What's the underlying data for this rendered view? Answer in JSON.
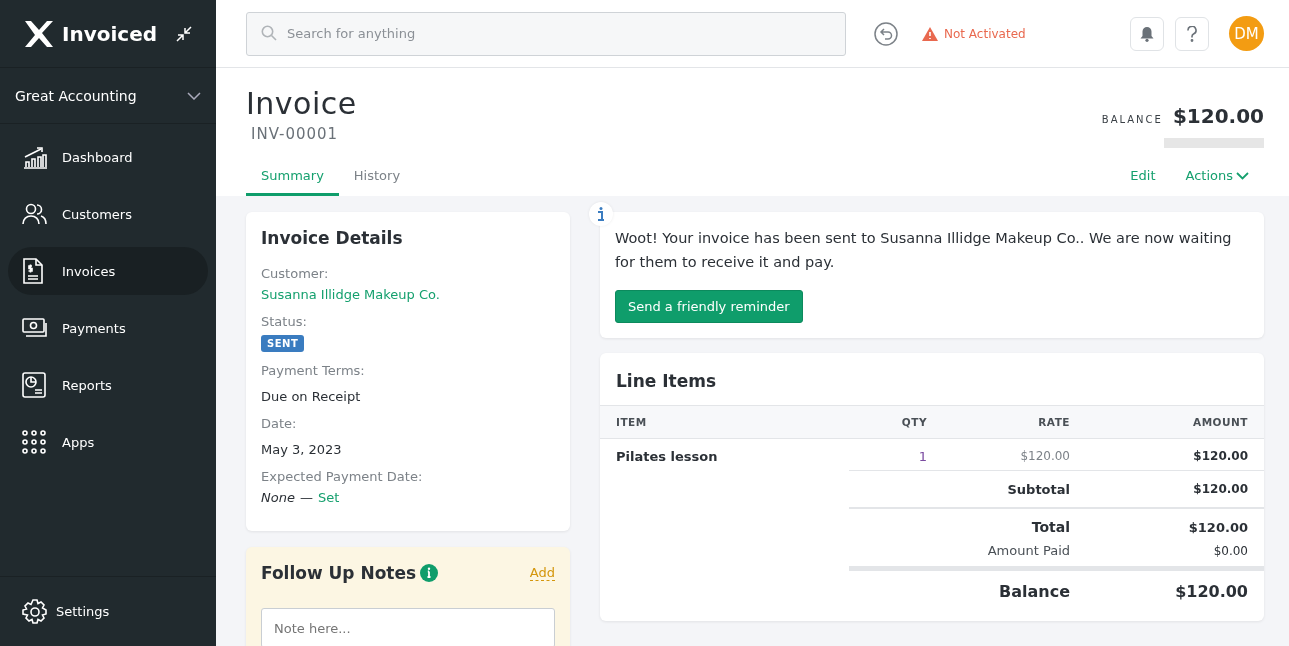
{
  "brand": {
    "name": "Invoiced"
  },
  "company": {
    "name": "Great Accounting"
  },
  "nav": [
    {
      "label": "Dashboard",
      "kind": "chart",
      "selected": false
    },
    {
      "label": "Customers",
      "kind": "people",
      "selected": false
    },
    {
      "label": "Invoices",
      "kind": "invoice",
      "selected": true
    },
    {
      "label": "Payments",
      "kind": "cash",
      "selected": false
    },
    {
      "label": "Reports",
      "kind": "report",
      "selected": false
    },
    {
      "label": "Apps",
      "kind": "grid",
      "selected": false
    }
  ],
  "settings": {
    "label": "Settings"
  },
  "search": {
    "placeholder": "Search for anything"
  },
  "activation": {
    "text": "Not Activated"
  },
  "avatar": {
    "initials": "DM"
  },
  "page": {
    "title": "Invoice",
    "number": "INV-00001",
    "balance_label": "BALANCE",
    "balance": "$120.00"
  },
  "tabs": [
    {
      "label": "Summary",
      "selected": true
    },
    {
      "label": "History",
      "selected": false
    }
  ],
  "actions": [
    {
      "label": "Edit",
      "kind": "link"
    },
    {
      "label": "Actions",
      "kind": "menu"
    }
  ],
  "details": {
    "title": "Invoice Details",
    "fields": [
      {
        "label": "Customer:",
        "value": "Susanna Illidge Makeup Co.",
        "kind": "link"
      },
      {
        "label": "Status:",
        "value": "SENT",
        "kind": "badge"
      },
      {
        "label": "Payment Terms:",
        "value": "Due on Receipt",
        "kind": "text"
      },
      {
        "label": "Date:",
        "value": "May 3, 2023",
        "kind": "text"
      },
      {
        "label": "Expected Payment Date:",
        "value": "None",
        "separator": "—",
        "action": "Set",
        "kind": "empty"
      }
    ]
  },
  "notes": {
    "title": "Follow Up Notes",
    "add": "Add",
    "placeholder": "Note here..."
  },
  "message": {
    "text": "Woot! Your invoice has been sent to Susanna Illidge Makeup Co.. We are now waiting for them to receive it and pay.",
    "button": "Send a friendly reminder"
  },
  "line_items": {
    "title": "Line Items",
    "columns": [
      "ITEM",
      "QTY",
      "RATE",
      "AMOUNT"
    ],
    "rows": [
      {
        "item": "Pilates lesson",
        "qty": "1",
        "rate": "$120.00",
        "amount": "$120.00"
      }
    ],
    "totals": [
      {
        "label": "Subtotal",
        "value": "$120.00",
        "kind": "subtotal"
      },
      {
        "label": "Total",
        "value": "$120.00",
        "kind": "total"
      },
      {
        "label": "Amount Paid",
        "value": "$0.00",
        "kind": "paid"
      },
      {
        "label": "Balance",
        "value": "$120.00",
        "kind": "balance"
      }
    ]
  }
}
